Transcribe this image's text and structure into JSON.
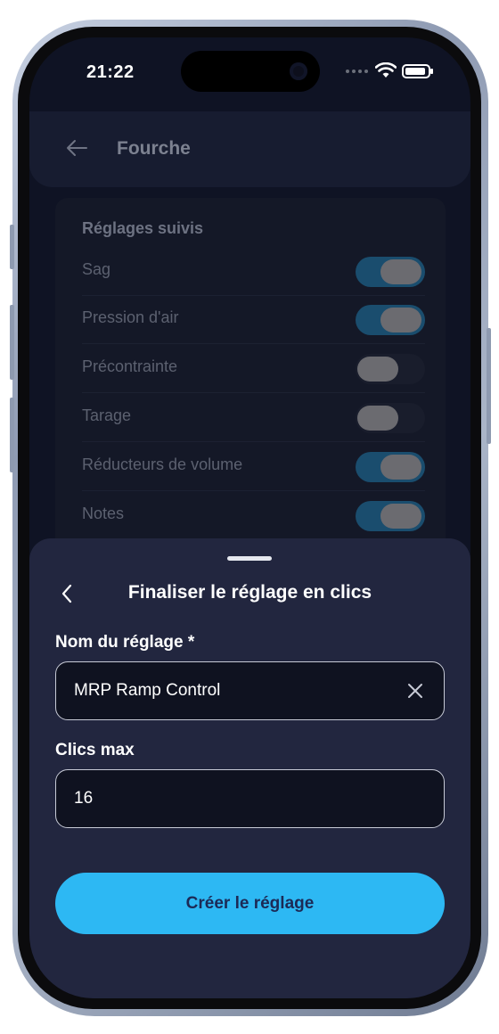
{
  "status_bar": {
    "time": "21:22"
  },
  "header": {
    "title": "Fourche",
    "back_icon": "arrow-left-icon"
  },
  "tracked_settings": {
    "title": "Réglages suivis",
    "items": [
      {
        "label": "Sag",
        "enabled": true
      },
      {
        "label": "Pression d'air",
        "enabled": true
      },
      {
        "label": "Précontrainte",
        "enabled": false
      },
      {
        "label": "Tarage",
        "enabled": false
      },
      {
        "label": "Réducteurs de volume",
        "enabled": true
      },
      {
        "label": "Notes",
        "enabled": true
      }
    ]
  },
  "sheet": {
    "title": "Finaliser le réglage en clics",
    "back_icon": "chevron-left-icon",
    "name_field": {
      "label": "Nom du réglage *",
      "value": "MRP Ramp Control",
      "clear_icon": "close-icon"
    },
    "max_clicks_field": {
      "label": "Clics max",
      "value": "16"
    },
    "submit_label": "Créer le réglage"
  },
  "colors": {
    "accent": "#2db8f3",
    "sheet_bg": "#22263f",
    "screen_bg": "#0f1324",
    "toggle_on": "#1a4d6e"
  }
}
